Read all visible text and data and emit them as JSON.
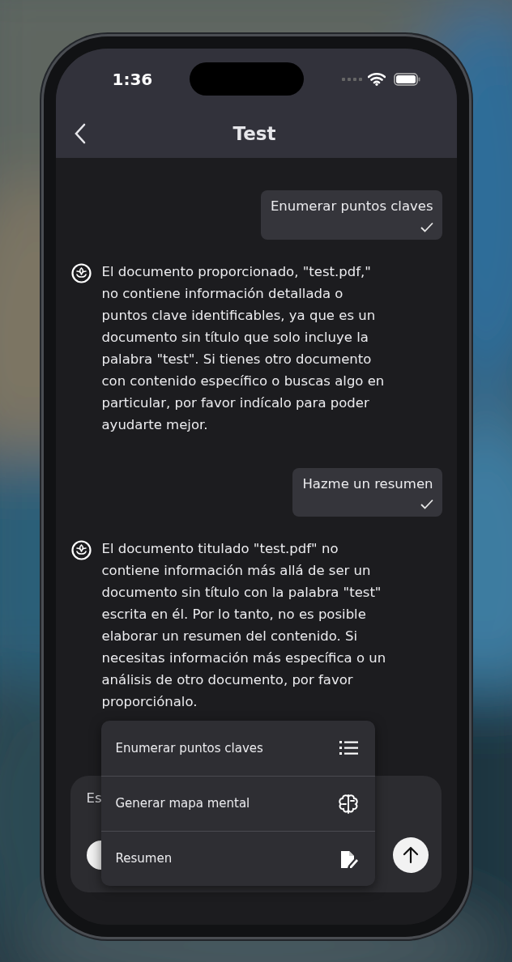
{
  "status_bar": {
    "time": "1:36"
  },
  "header": {
    "title": "Test"
  },
  "messages": [
    {
      "kind": "user",
      "text": "Enumerar puntos claves",
      "delivered": true
    },
    {
      "kind": "bot",
      "text": "El documento proporcionado, \"test.pdf,\" no contiene información detallada o puntos clave identificables, ya que es un documento sin título que solo incluye la palabra \"test\". Si tienes otro documento con contenido específico o buscas algo en particular, por favor indícalo para poder ayudarte mejor."
    },
    {
      "kind": "user",
      "text": "Hazme un resumen",
      "delivered": true
    },
    {
      "kind": "bot",
      "text": "El documento titulado \"test.pdf\" no contiene información más allá de ser un documento sin título con la palabra \"test\" escrita en él. Por lo tanto, no es posible elaborar un resumen del contenido. Si necesitas información más específica o un análisis de otro documento, por favor proporciónalo."
    }
  ],
  "menu": {
    "items": [
      {
        "label": "Enumerar puntos claves"
      },
      {
        "label": "Generar mapa mental"
      },
      {
        "label": "Resumen"
      }
    ]
  },
  "input": {
    "placeholder": "Es"
  }
}
